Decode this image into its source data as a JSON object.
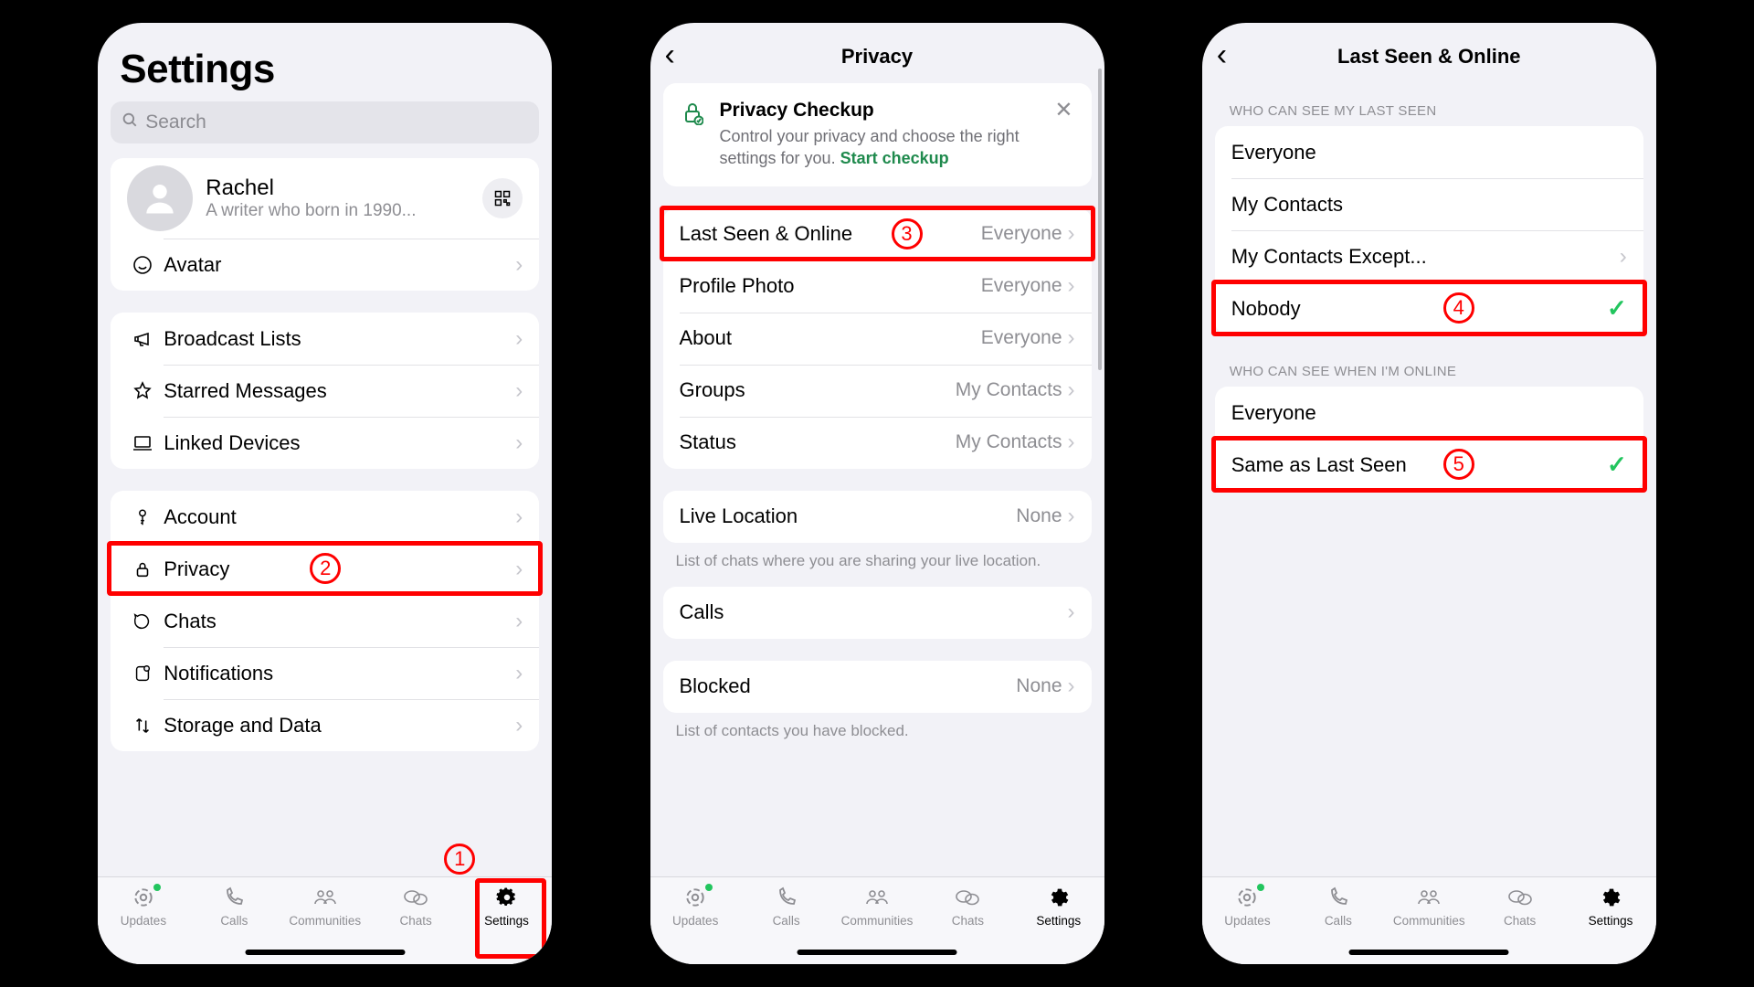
{
  "settings_screen": {
    "title": "Settings",
    "search_placeholder": "Search",
    "profile": {
      "name": "Rachel",
      "bio": "A writer who born in 1990..."
    },
    "avatar_label": "Avatar",
    "group1": [
      {
        "label": "Broadcast Lists"
      },
      {
        "label": "Starred Messages"
      },
      {
        "label": "Linked Devices"
      }
    ],
    "group2": [
      {
        "label": "Account"
      },
      {
        "label": "Privacy"
      },
      {
        "label": "Chats"
      },
      {
        "label": "Notifications"
      },
      {
        "label": "Storage and Data"
      }
    ]
  },
  "privacy_screen": {
    "title": "Privacy",
    "checkup": {
      "title": "Privacy Checkup",
      "body_prefix": "Control your privacy and choose the right settings for you. ",
      "link": "Start checkup"
    },
    "rows": [
      {
        "label": "Last Seen & Online",
        "value": "Everyone"
      },
      {
        "label": "Profile Photo",
        "value": "Everyone"
      },
      {
        "label": "About",
        "value": "Everyone"
      },
      {
        "label": "Groups",
        "value": "My Contacts"
      },
      {
        "label": "Status",
        "value": "My Contacts"
      }
    ],
    "live_location": {
      "label": "Live Location",
      "value": "None"
    },
    "live_location_note": "List of chats where you are sharing your live location.",
    "calls": {
      "label": "Calls"
    },
    "blocked": {
      "label": "Blocked",
      "value": "None"
    },
    "blocked_note": "List of contacts you have blocked."
  },
  "lastseen_screen": {
    "title": "Last Seen & Online",
    "sec1_header": "WHO CAN SEE MY LAST SEEN",
    "sec1": [
      {
        "label": "Everyone"
      },
      {
        "label": "My Contacts"
      },
      {
        "label": "My Contacts Except...",
        "chevron": true
      },
      {
        "label": "Nobody",
        "checked": true
      }
    ],
    "sec2_header": "WHO CAN SEE WHEN I'M ONLINE",
    "sec2": [
      {
        "label": "Everyone"
      },
      {
        "label": "Same as Last Seen",
        "checked": true
      }
    ]
  },
  "tabs": [
    {
      "label": "Updates"
    },
    {
      "label": "Calls"
    },
    {
      "label": "Communities"
    },
    {
      "label": "Chats"
    },
    {
      "label": "Settings"
    }
  ],
  "annotations": {
    "n1": "1",
    "n2": "2",
    "n3": "3",
    "n4": "4",
    "n5": "5"
  }
}
